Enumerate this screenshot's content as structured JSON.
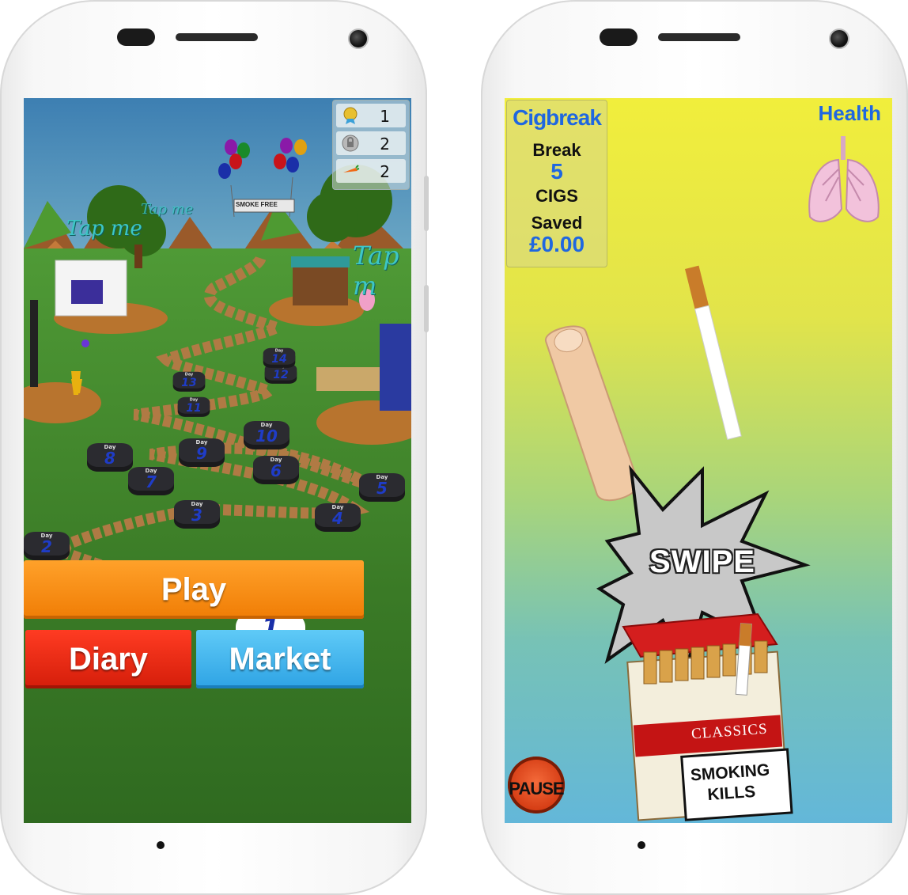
{
  "left_screen": {
    "counters": [
      {
        "icon": "medal-icon",
        "value": "1"
      },
      {
        "icon": "lock-icon",
        "value": "2"
      },
      {
        "icon": "carrot-icon",
        "value": "2"
      }
    ],
    "signs": {
      "tap_me_left": "Tap me",
      "tap_me_right": "Tap m",
      "tap_me_back": "Tap me",
      "banner": "SMOKE FREE"
    },
    "day_label": "Day",
    "days": [
      "1",
      "2",
      "3",
      "4",
      "5",
      "6",
      "7",
      "8",
      "9",
      "10",
      "11",
      "12",
      "13",
      "14"
    ],
    "buttons": {
      "play": "Play",
      "diary": "Diary",
      "market": "Market"
    },
    "colors": {
      "play": "#f58a10",
      "diary": "#ea2d15",
      "market": "#3bb3ef"
    }
  },
  "right_screen": {
    "title": "Cigbreak",
    "break_label": "Break",
    "break_value": "5",
    "cigs_label": "CIGS",
    "saved_label": "Saved",
    "saved_value": "£0.00",
    "health_label": "Health",
    "swipe_label": "SWIPE",
    "pack_brand": "CLASSICS",
    "warning_line1": "SMOKING",
    "warning_line2": "KILLS",
    "pause_label": "PAUSE",
    "icons": [
      "lungs-icon",
      "finger-icon",
      "cigarette-icon",
      "cigarette-pack-icon"
    ]
  }
}
